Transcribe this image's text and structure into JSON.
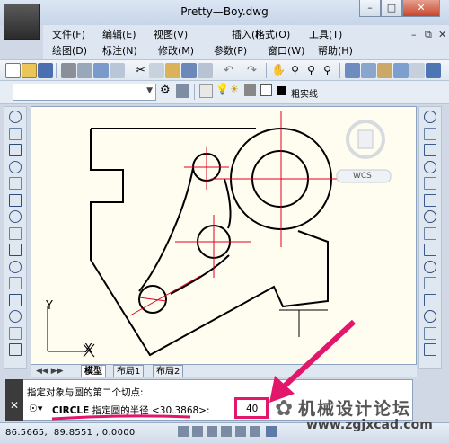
{
  "window": {
    "title": "Pretty—Boy.dwg"
  },
  "menu": {
    "row1": [
      "文件(F)",
      "编辑(E)",
      "视图(V)",
      "插入(I)",
      "格式(O)",
      "工具(T)"
    ],
    "row2": [
      "绘图(D)",
      "标注(N)",
      "修改(M)",
      "参数(P)",
      "窗口(W)",
      "帮助(H)"
    ]
  },
  "toolbar2": {
    "linetype": "粗实线"
  },
  "viewcube": {
    "wcs": "WCS"
  },
  "ucs": {
    "y": "Y",
    "x": "X"
  },
  "tabs": [
    "模型",
    "布局1",
    "布局2"
  ],
  "command": {
    "prompt1": "指定对象与圆的第二个切点:",
    "circle": "CIRCLE",
    "prompt2": "指定圆的半径 <30.3868>:",
    "input": "40"
  },
  "status": {
    "coords": "86.5665,  89.8551 , 0.0000"
  },
  "watermark": {
    "forum": "机械设计论坛",
    "url": "www.zgjxcad.com"
  },
  "colors": {
    "highlight": "#e2166a",
    "centerline": "#e0001b",
    "canvas": "#fffdf0"
  }
}
